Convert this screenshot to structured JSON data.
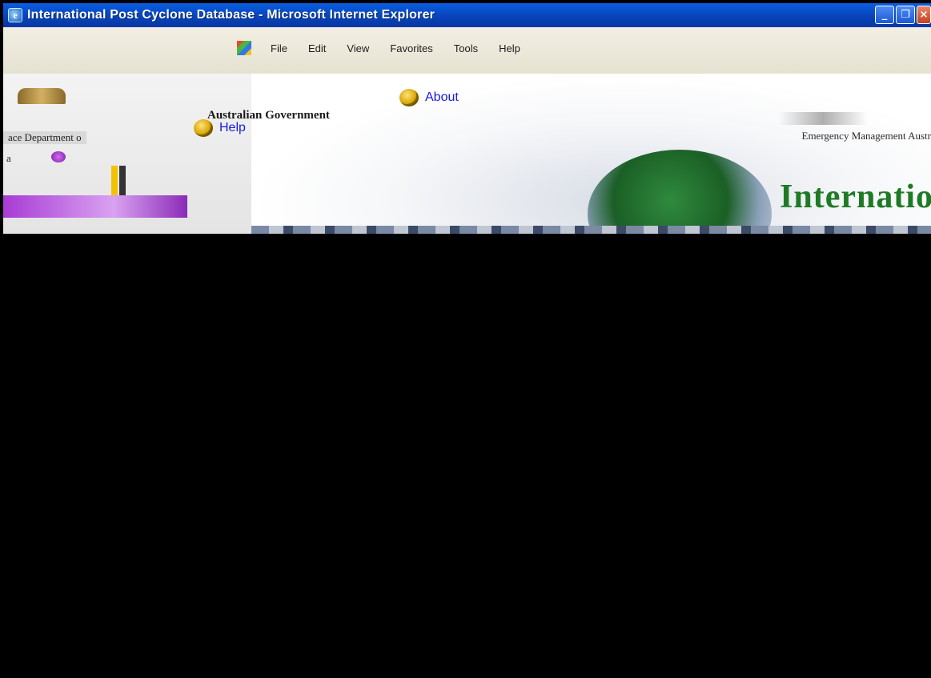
{
  "window": {
    "title": "International Post Cyclone Database - Microsoft Internet Explorer",
    "icon": "ie-icon",
    "controls": [
      "minimize-icon",
      "restore-icon",
      "close-icon"
    ]
  },
  "menubar": {
    "items": [
      "File",
      "Edit",
      "View",
      "Favorites",
      "Tools",
      "Help"
    ]
  },
  "header": {
    "government": "Australian Government",
    "department": "ace Department o",
    "region": "a"
  },
  "nav": {
    "about_label": "About",
    "help_label": "Help"
  },
  "banner": {
    "agency": "Emergency Management Austr",
    "title": "International"
  },
  "colors": {
    "titlebar": "#0842b8",
    "link": "#1818e6",
    "banner_title": "#1f7a25",
    "accent_purple": "#a83bd6"
  }
}
